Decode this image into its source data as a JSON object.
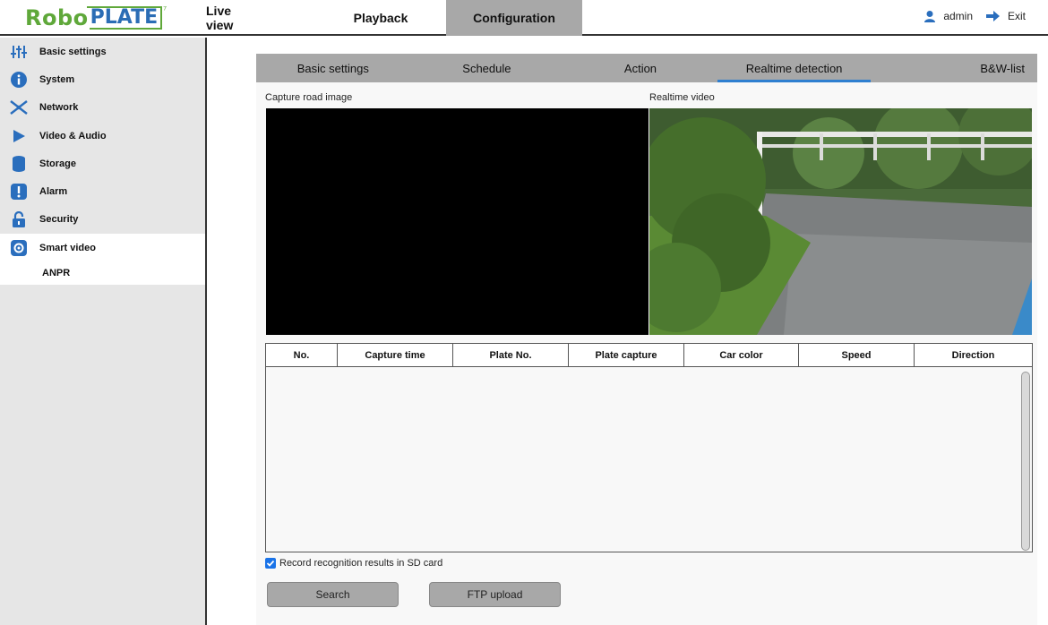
{
  "brand": {
    "robo": "Robo",
    "plate": "PLATE",
    "mark": "⁷"
  },
  "nav": {
    "live_view": "Live view",
    "playback": "Playback",
    "configuration": "Configuration"
  },
  "user": {
    "name": "admin",
    "exit": "Exit"
  },
  "sidebar": {
    "items": [
      {
        "label": "Basic settings",
        "icon": "sliders-icon"
      },
      {
        "label": "System",
        "icon": "info-icon"
      },
      {
        "label": "Network",
        "icon": "network-icon"
      },
      {
        "label": "Video & Audio",
        "icon": "play-icon"
      },
      {
        "label": "Storage",
        "icon": "storage-icon"
      },
      {
        "label": "Alarm",
        "icon": "alarm-icon"
      },
      {
        "label": "Security",
        "icon": "lock-icon"
      },
      {
        "label": "Smart video",
        "icon": "gear-icon"
      }
    ],
    "sub_item": "ANPR"
  },
  "tabs": [
    "Basic settings",
    "Schedule",
    "Action",
    "Realtime detection",
    "B&W-list"
  ],
  "labels": {
    "capture": "Capture road image",
    "realtime": "Realtime video"
  },
  "table": {
    "columns": [
      "No.",
      "Capture time",
      "Plate No.",
      "Plate capture",
      "Car color",
      "Speed",
      "Direction"
    ]
  },
  "checkbox_label": "Record recognition results in SD card",
  "buttons": {
    "search": "Search",
    "ftp": "FTP upload"
  },
  "colors": {
    "accent": "#2f7fd0",
    "brand_green": "#5fa83a",
    "brand_blue": "#2b6db5",
    "icon_blue": "#2a6ebd"
  }
}
